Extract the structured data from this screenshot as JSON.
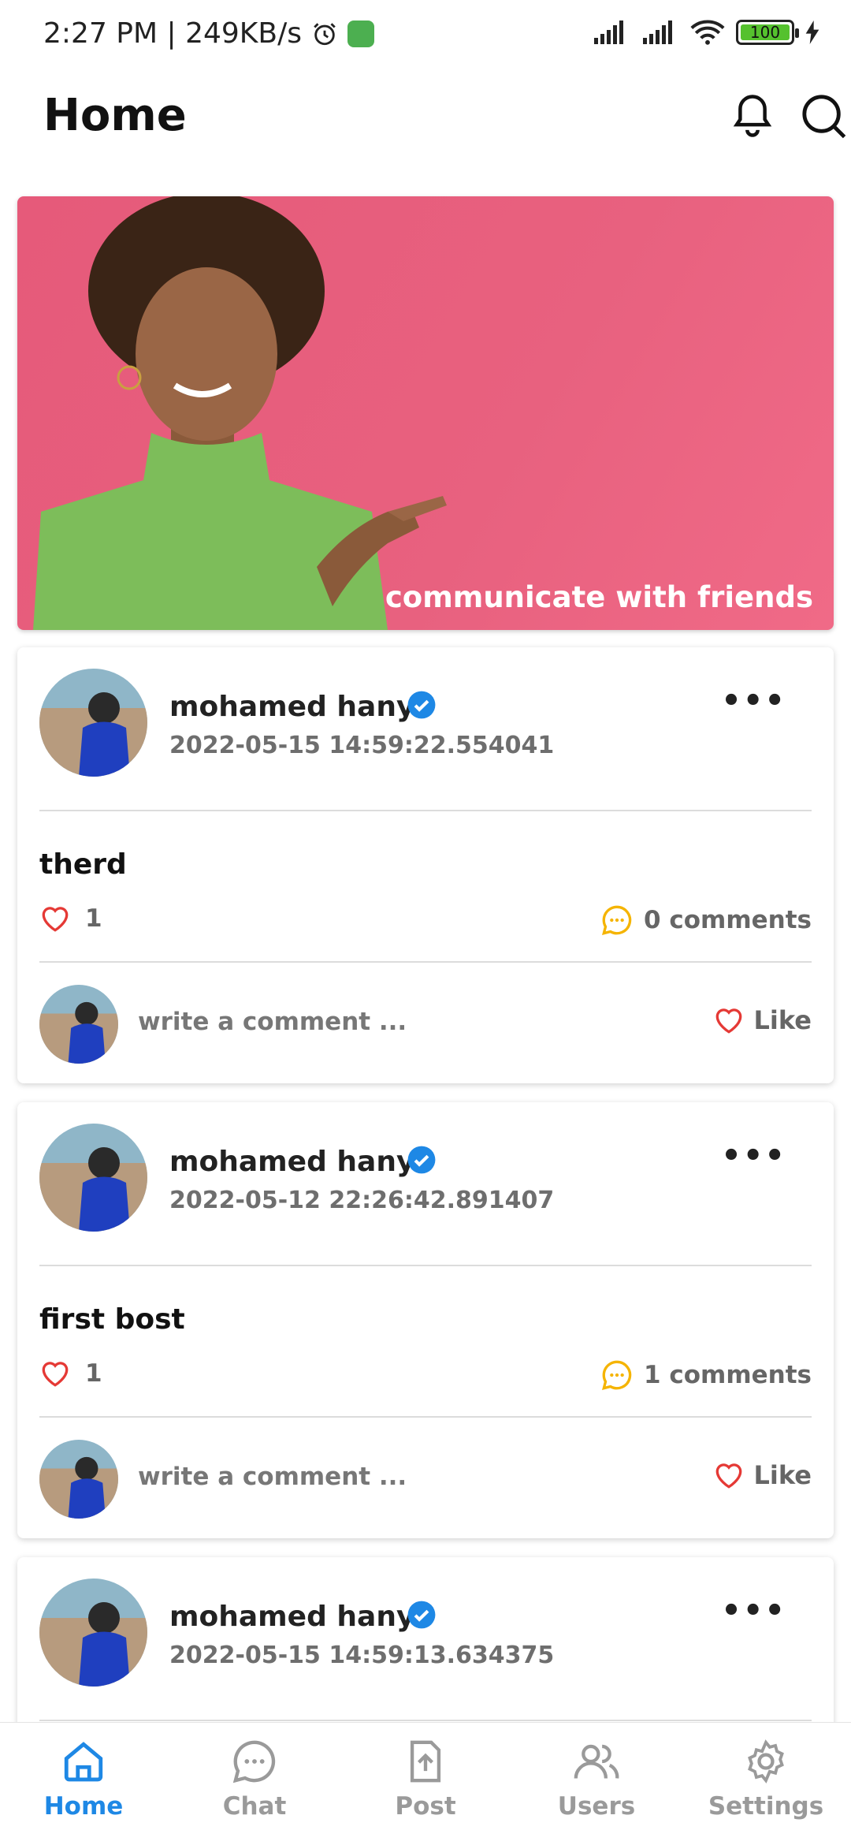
{
  "status_bar": {
    "time_speed": "2:27 PM | 249KB/s",
    "battery": "100"
  },
  "header": {
    "title": "Home"
  },
  "banner": {
    "caption": "communicate with friends"
  },
  "composer": {
    "placeholder": "write a comment ...",
    "like_label": "Like"
  },
  "posts": [
    {
      "author": "mohamed hany",
      "date": "2022-05-15 14:59:22.554041",
      "text": "therd",
      "likes": "1",
      "comments": "0 comments"
    },
    {
      "author": "mohamed hany",
      "date": "2022-05-12 22:26:42.891407",
      "text": "first bost",
      "likes": "1",
      "comments": "1 comments"
    },
    {
      "author": "mohamed hany",
      "date": "2022-05-15 14:59:13.634375"
    }
  ],
  "nav": {
    "items": [
      {
        "label": "Home",
        "icon": "home-icon",
        "active": true
      },
      {
        "label": "Chat",
        "icon": "chat-icon"
      },
      {
        "label": "Post",
        "icon": "upload-icon"
      },
      {
        "label": "Users",
        "icon": "users-icon"
      },
      {
        "label": "Settings",
        "icon": "gear-icon"
      }
    ]
  },
  "colors": {
    "accent": "#1e88e5",
    "banner": "#e8617f",
    "heart": "#e53935",
    "comment": "#f5b400"
  }
}
